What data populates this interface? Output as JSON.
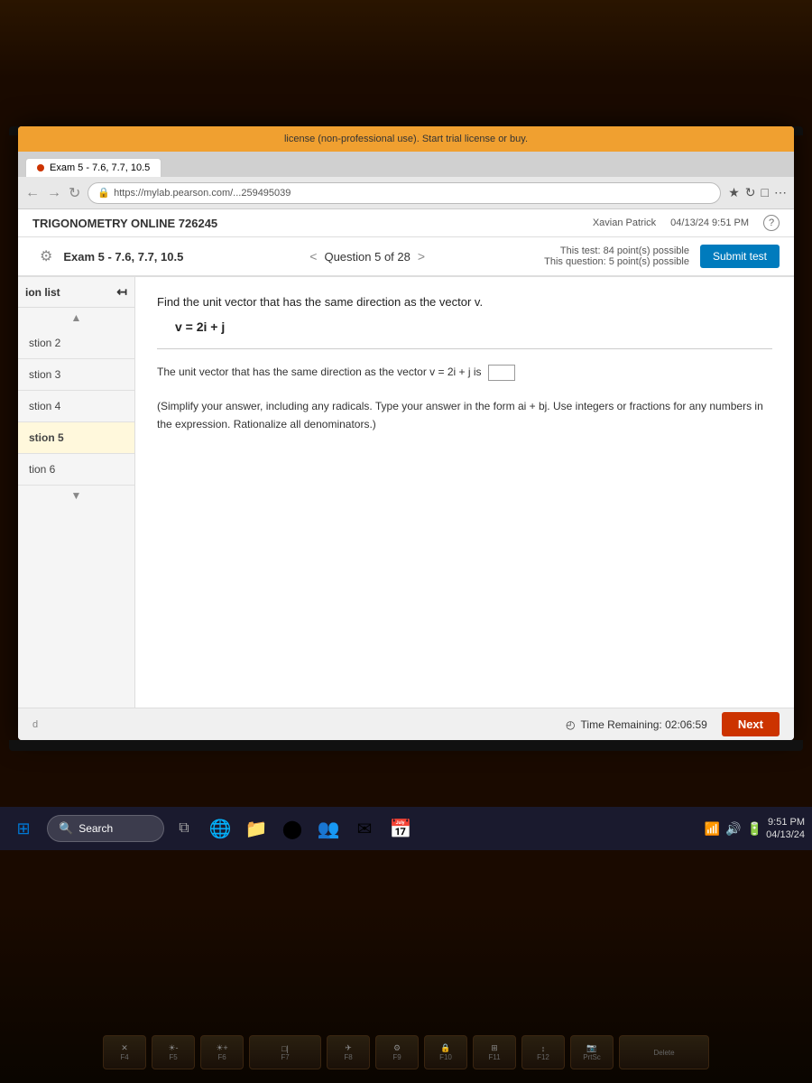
{
  "browser": {
    "license_text": "license (non-professional use). Start trial license or buy.",
    "tab_label": "Exam 5 - 7.6, 7.7, 10.5",
    "url": "https://mylab.pearson.com/...259495039"
  },
  "pearson": {
    "site_title": "TRIGONOMETRY ONLINE 726245",
    "user_name": "Xavian Patrick",
    "date_time": "04/13/24 9:51 PM"
  },
  "exam": {
    "title": "Exam 5 - 7.6, 7.7, 10.5",
    "question_label": "Question 5 of 28",
    "total_points": "This test: 84 point(s) possible",
    "question_points": "This question: 5 point(s) possible",
    "submit_label": "Submit test"
  },
  "sidebar": {
    "header_label": "ion list",
    "items": [
      {
        "label": "stion 2"
      },
      {
        "label": "stion 3"
      },
      {
        "label": "stion 4"
      },
      {
        "label": "stion 5",
        "active": true
      },
      {
        "label": "tion 6"
      }
    ]
  },
  "question": {
    "prompt": "Find the unit vector that has the same direction as the vector v.",
    "vector": "v = 2i + j",
    "answer_text": "The unit vector that has the same direction as the vector v = 2i + j is",
    "instruction": "(Simplify your answer, including any radicals. Type your answer in the form ai + bj. Use integers or fractions for any numbers in the expression. Rationalize all denominators.)"
  },
  "bottom": {
    "time_label": "Time Remaining: 02:06:59",
    "next_label": "Next",
    "left_label": "d"
  },
  "taskbar": {
    "search_placeholder": "Search",
    "time": "9:51 PM",
    "date": "04/13/24"
  },
  "keyboard": {
    "keys_row1": [
      "F4",
      "F5",
      "F6",
      "F7",
      "F8",
      "F9",
      "F10",
      "F11",
      "F12",
      "PrtSc",
      "Delete"
    ]
  }
}
